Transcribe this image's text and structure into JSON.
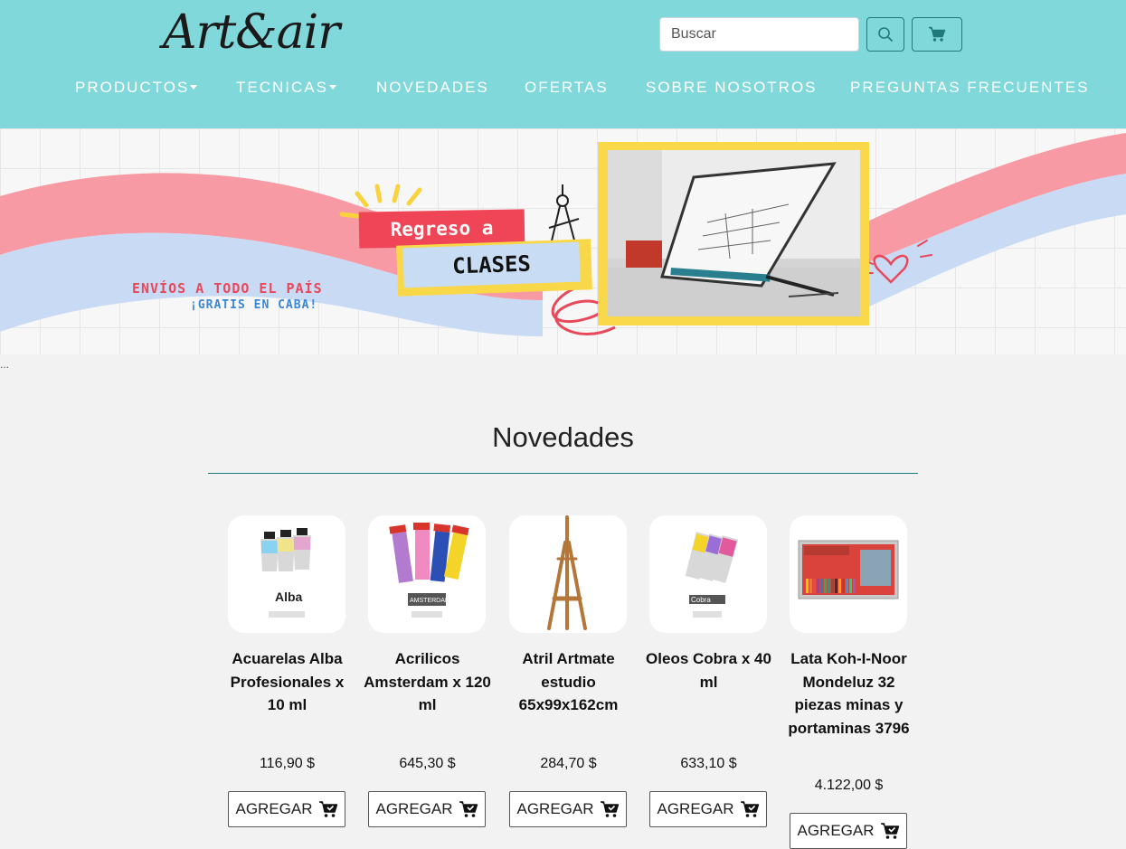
{
  "header": {
    "logo": "Art&air",
    "search_placeholder": "Buscar",
    "accent_color": "#81d8db",
    "nav": [
      {
        "label": "PRODUCTOS",
        "dropdown": true
      },
      {
        "label": "TECNICAS",
        "dropdown": true
      },
      {
        "label": "NOVEDADES",
        "dropdown": false
      },
      {
        "label": "OFERTAS",
        "dropdown": false
      },
      {
        "label": "SOBRE NOSOTROS",
        "dropdown": false
      },
      {
        "label": "PREGUNTAS FRECUENTES",
        "dropdown": false
      }
    ]
  },
  "banner": {
    "envios": "ENVÍOS A TODO EL PAÍS",
    "gratis": "¡GRATIS EN CABA!",
    "headline_1": "Regreso a",
    "headline_2": "CLASES"
  },
  "ellipsis": "...",
  "section": {
    "title": "Novedades",
    "products": [
      {
        "name": "Acuarelas Alba Profesionales x 10 ml",
        "price": "116,90 $",
        "button": "AGREGAR",
        "image": "watercolor-tubes"
      },
      {
        "name": "Acrilicos Amsterdam x 120 ml",
        "price": "645,30 $",
        "button": "AGREGAR",
        "image": "acrylic-tubes"
      },
      {
        "name": "Atril Artmate estudio 65x99x162cm",
        "price": "284,70 $",
        "button": "AGREGAR",
        "image": "wooden-easel"
      },
      {
        "name": "Oleos Cobra x 40 ml",
        "price": "633,10 $",
        "button": "AGREGAR",
        "image": "oil-tubes"
      },
      {
        "name": "Lata Koh-I-Noor Mondeluz 32 piezas minas y portaminas 3796",
        "price": "4.122,00 $",
        "button": "AGREGAR",
        "image": "pencil-tin"
      }
    ]
  }
}
